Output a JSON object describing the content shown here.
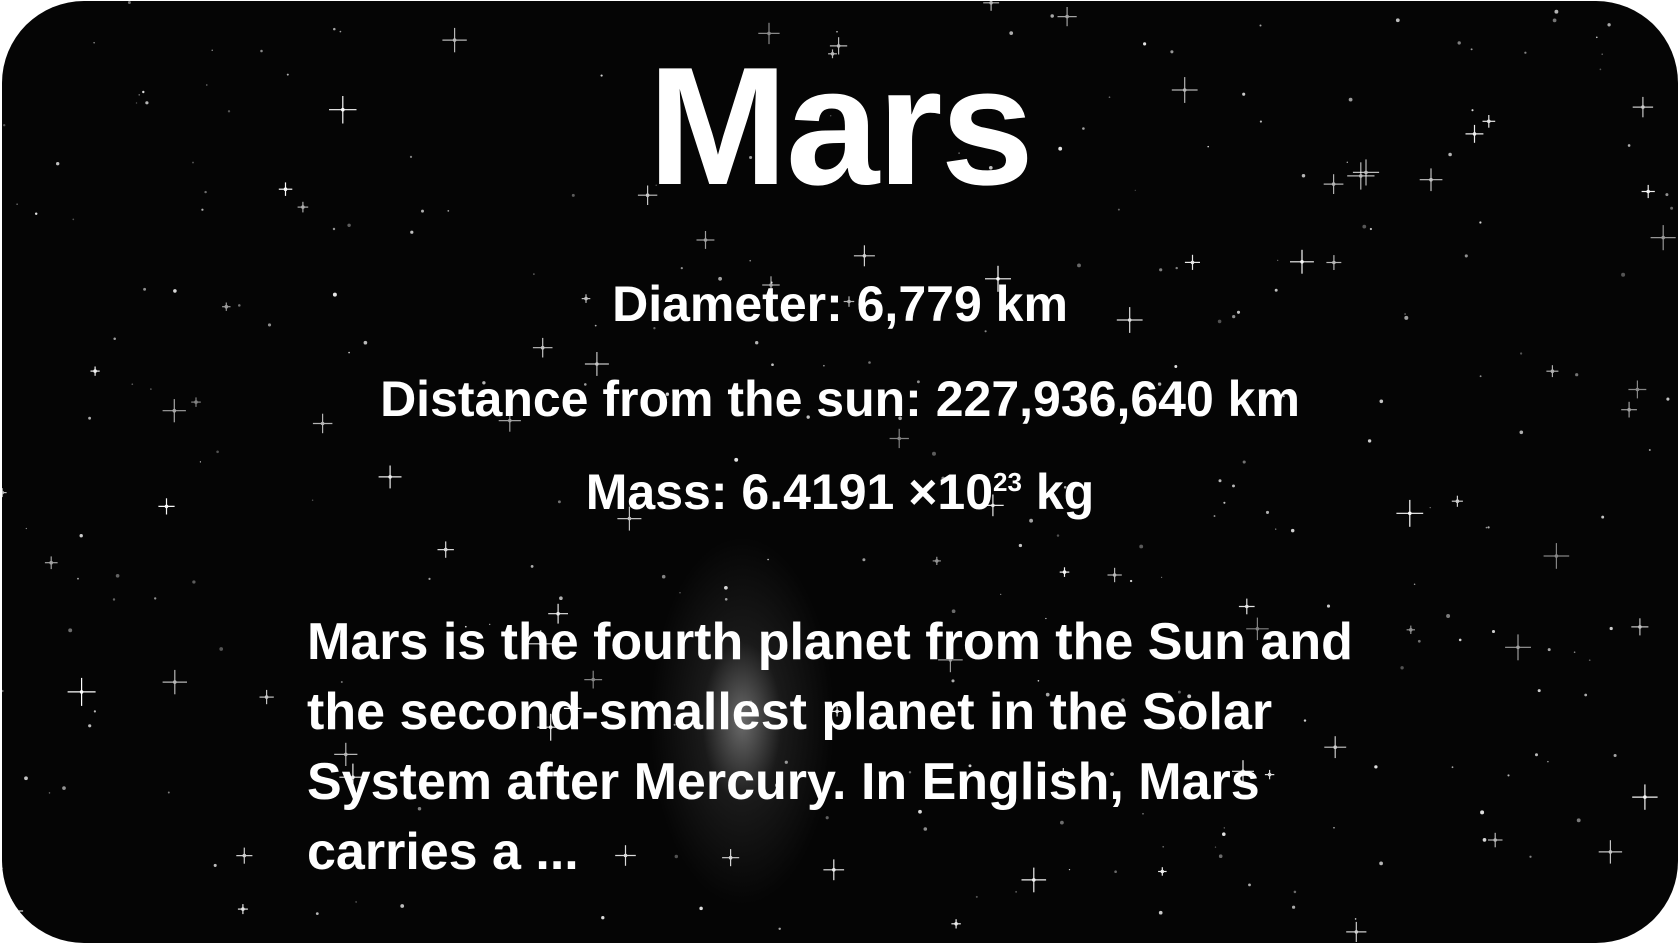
{
  "title": "Mars",
  "stats": {
    "diameter_label": "Diameter: 6,779 km",
    "distance_label": "Distance from the sun: 227,936,640 km",
    "mass_prefix": "Mass: 6.4191 ×10",
    "mass_exponent": "23",
    "mass_unit": " kg"
  },
  "description": "Mars is the fourth planet from the Sun and the second-smallest planet in the Solar System after Mercury. In English, Mars carries a ...",
  "colors": {
    "background": "#050505",
    "text": "#ffffff",
    "page": "#ffffff"
  }
}
